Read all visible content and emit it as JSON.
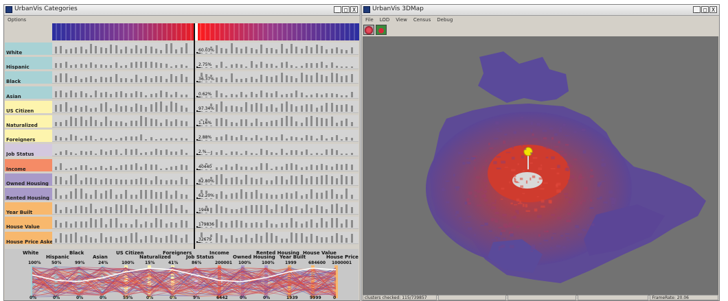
{
  "categories_window": {
    "title": "UrbanVis Categories",
    "menu": [
      "Options"
    ],
    "window_buttons": [
      "_",
      "□",
      "X"
    ],
    "rows": [
      {
        "label": "White",
        "value": "60.03%",
        "color": "#a8d2d5"
      },
      {
        "label": "Hispanic",
        "value": "2.75%",
        "color": "#a8d2d5"
      },
      {
        "label": "Black",
        "value": "36.37%",
        "color": "#a8d2d5"
      },
      {
        "label": "Asian",
        "value": "0.62%",
        "color": "#a8d2d5"
      },
      {
        "label": "US Citizen",
        "value": "97.34%",
        "color": "#fdf4ad"
      },
      {
        "label": "Naturalized",
        "value": "1.16%",
        "color": "#fdf4ad"
      },
      {
        "label": "Foreigners",
        "value": "2.88%",
        "color": "#fdf4ad"
      },
      {
        "label": "Job Status",
        "value": "2.%...",
        "color": "#d3c8df"
      },
      {
        "label": "Income",
        "value": "40440",
        "color": "#f58b66"
      },
      {
        "label": "Owned Housing",
        "value": "82.80%",
        "color": "#a89ac9"
      },
      {
        "label": "Rented Housing",
        "value": "62.20%",
        "color": "#a89ac9"
      },
      {
        "label": "Year Built",
        "value": "1948",
        "color": "#f8b86d"
      },
      {
        "label": "House Value",
        "value": "179836",
        "color": "#f8b86d"
      },
      {
        "label": "House Price Asked",
        "value": "32679",
        "color": "#f8b86d"
      }
    ],
    "pcp": {
      "axes": [
        {
          "label": "White",
          "top": "100%",
          "bottom": "0%",
          "color": "#a8d2d5"
        },
        {
          "label": "Hispanic",
          "top": "50%",
          "bottom": "0%",
          "color": "#a8d2d5"
        },
        {
          "label": "Black",
          "top": "99%",
          "bottom": "0%",
          "color": "#a8d2d5"
        },
        {
          "label": "Asian",
          "top": "24%",
          "bottom": "0%",
          "color": "#a8d2d5"
        },
        {
          "label": "US Citizen",
          "top": "100%",
          "bottom": "59%",
          "color": "#fdf4ad"
        },
        {
          "label": "Naturalized",
          "top": "15%",
          "bottom": "0%",
          "color": "#fdf4ad"
        },
        {
          "label": "Foreigners",
          "top": "41%",
          "bottom": "0%",
          "color": "#fdf4ad"
        },
        {
          "label": "Job Status",
          "top": "86%",
          "bottom": "9%",
          "color": "#d3c8df"
        },
        {
          "label": "Income",
          "top": "200001",
          "bottom": "6442",
          "color": "#f58b66"
        },
        {
          "label": "Owned Housing",
          "top": "100%",
          "bottom": "0%",
          "color": "#a89ac9"
        },
        {
          "label": "Rented Housing",
          "top": "100%",
          "bottom": "0%",
          "color": "#a89ac9"
        },
        {
          "label": "Year Built",
          "top": "1999",
          "bottom": "1939",
          "color": "#f8b86d"
        },
        {
          "label": "House Value",
          "top": "684600",
          "bottom": "9999",
          "color": "#f8b86d"
        },
        {
          "label": "House Price Asked",
          "top": "1000001",
          "bottom": "0",
          "color": "#f8b86d"
        }
      ]
    }
  },
  "map_window": {
    "title": "UrbanVis 3DMap",
    "menu": [
      "File",
      "LOD",
      "View",
      "Census",
      "Debug"
    ],
    "window_buttons": [
      "_",
      "□",
      "X"
    ],
    "toolbar": [
      {
        "icon": "red-cluster-icon",
        "color": "#c8344a"
      },
      {
        "icon": "green-red-map-icon",
        "color": "#3b8a3b"
      }
    ],
    "status": {
      "clusters": "clusters checked: 115/739857",
      "framerate": "FrameRate: 20.06"
    },
    "colors": {
      "background": "#727272",
      "outer": "#5a4a9a",
      "inner": "#c93a34",
      "marker": "#f3e400"
    }
  }
}
